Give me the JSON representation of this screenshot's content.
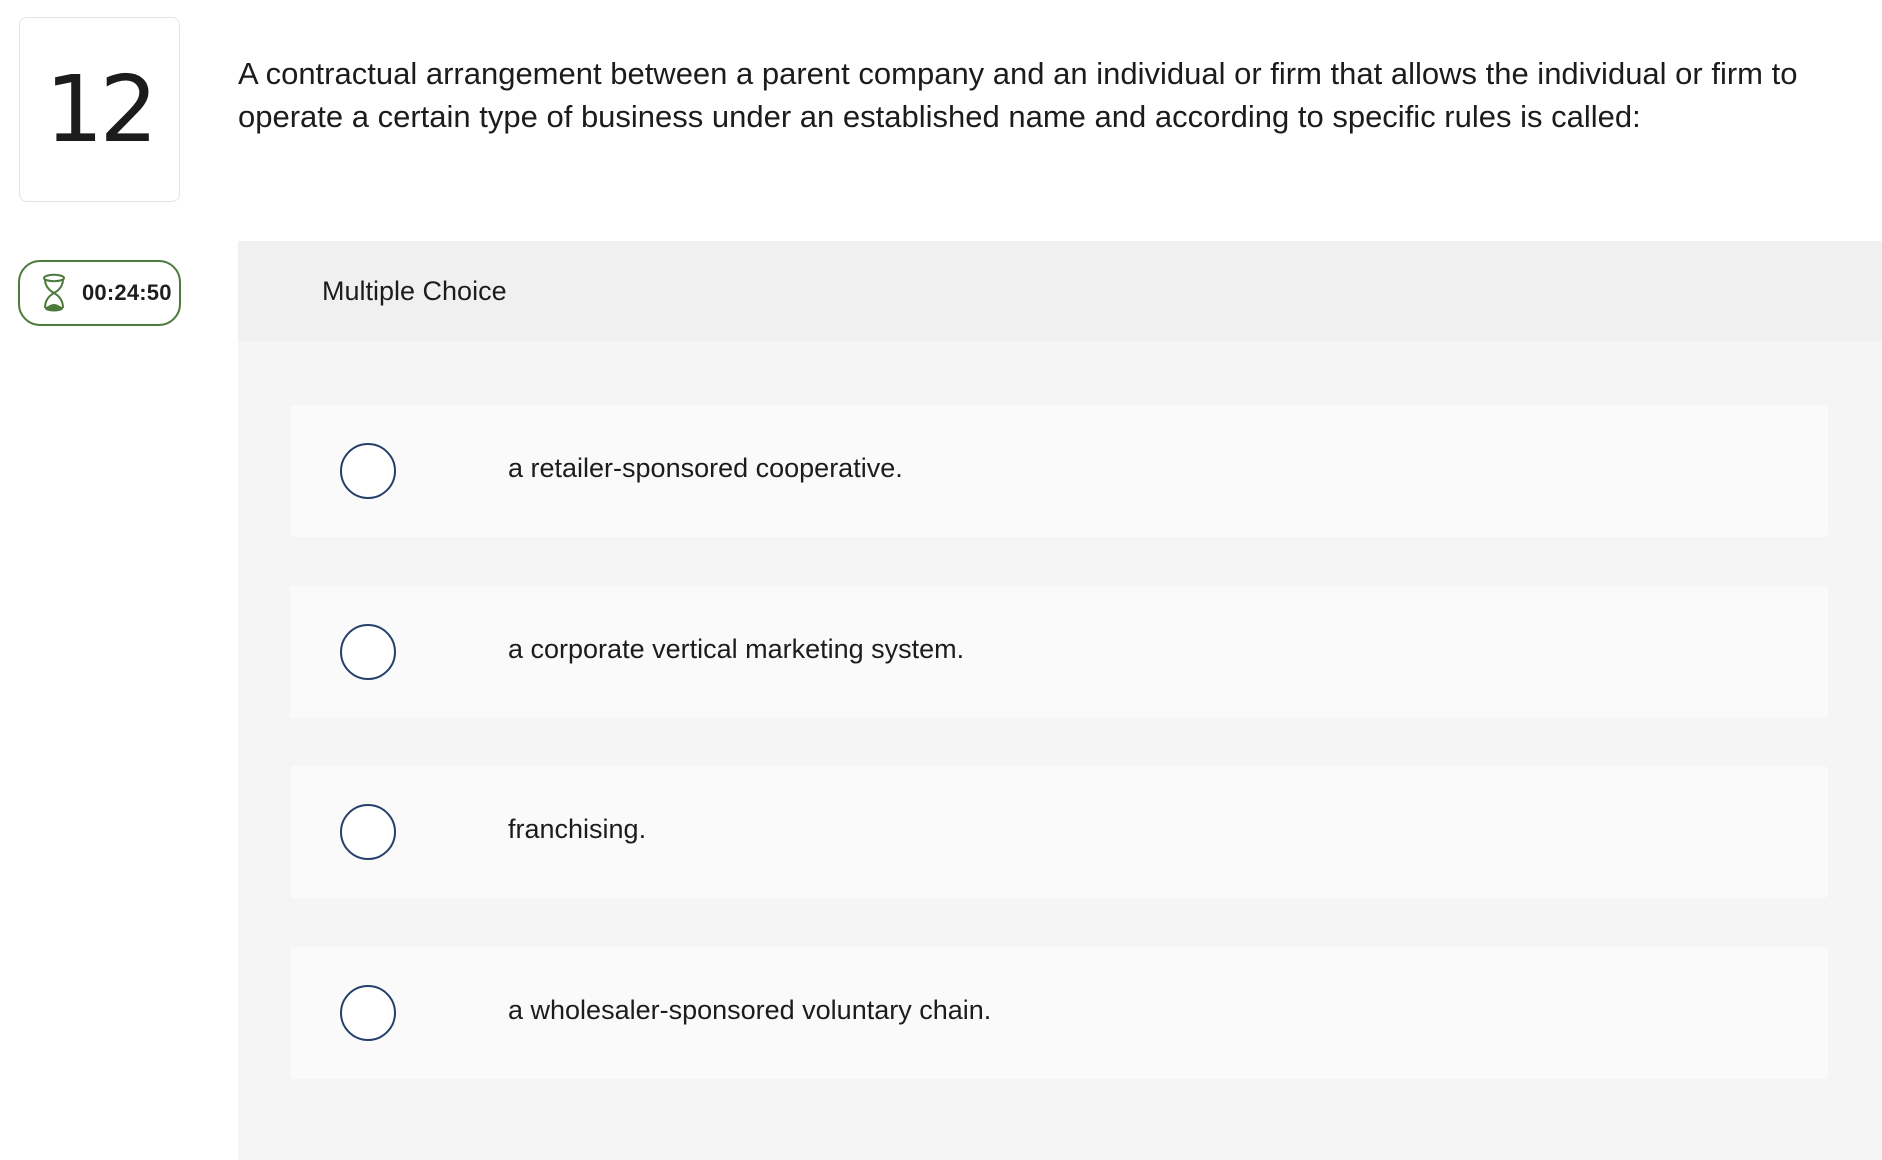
{
  "question": {
    "number": "12",
    "text": "A contractual arrangement between a parent company and an individual or firm that allows the individual or firm to operate a certain type of business under an established name and according to specific rules is called:"
  },
  "timer": {
    "icon": "hourglass-icon",
    "value": "00:24:50",
    "color": "#4b7a3c"
  },
  "panel": {
    "type_label": "Multiple Choice"
  },
  "options": [
    {
      "text": "a retailer-sponsored cooperative.",
      "selected": false
    },
    {
      "text": "a corporate vertical marketing system.",
      "selected": false
    },
    {
      "text": "franchising.",
      "selected": false
    },
    {
      "text": "a wholesaler-sponsored voluntary chain.",
      "selected": false
    }
  ],
  "colors": {
    "radio_border": "#24406a",
    "panel_bg": "#f5f5f5",
    "option_bg": "#fafafa"
  }
}
